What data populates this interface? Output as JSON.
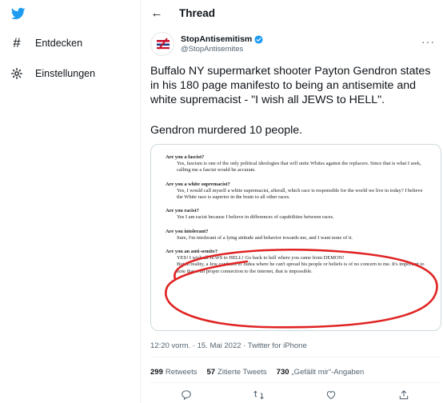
{
  "sidebar": {
    "items": [
      {
        "icon": "hashtag-icon",
        "label": "Entdecken"
      },
      {
        "icon": "gear-icon",
        "label": "Einstellungen"
      }
    ]
  },
  "header": {
    "title": "Thread"
  },
  "tweet": {
    "display_name": "StopAntisemitism",
    "handle": "@StopAntisemites",
    "text": "Buffalo NY supermarket shooter Payton Gendron states in his 180 page manifesto to being an antisemite and white supremacist - \"I wish all JEWS to HELL\".",
    "text2": "Gendron murdered 10 people.",
    "timestamp": "12:20 vorm. · 15. Mai 2022 · Twitter for iPhone",
    "retweets_count": "299",
    "retweets_label": "Retweets",
    "quotes_count": "57",
    "quotes_label": "Zitierte Tweets",
    "likes_count": "730",
    "likes_label": "„Gefällt mir“-Angaben"
  },
  "document": {
    "qa": [
      {
        "q": "Are you a fascist?",
        "a": "Yes, fascism is one of the only political ideologies that will unite Whites against the replacers. Since that is what I seek, calling me a fascist would be accurate."
      },
      {
        "q": "Are you a white supremacist?",
        "a": "Yes, I would call myself a white supremacist, afterall, which race is responsible for the world we live in today? I believe the White race is superior in the brain to all other races."
      },
      {
        "q": "Are you racist?",
        "a": "Yes I am racist because I believe in differences of capabilities between races."
      },
      {
        "q": "Are you intolerant?",
        "a": "Sure, I'm intolerant of a lying attitude and behavior towards me, and I want none of it."
      },
      {
        "q": "Are you an anti-semite?",
        "a": "YES! I wish all JEWS to HELL! Go back to hell where you came from DEMON!"
      },
      {
        "q": "",
        "a": "But in reality, a Jew confined to Judea where he can't spread his people or beliefs is of no concern to me. It's important to note that with proper connection to the internet, that is impossible."
      }
    ]
  },
  "colors": {
    "twitter_blue": "#1d9bf0",
    "circle_red": "#e02424",
    "text_secondary": "#536471"
  }
}
